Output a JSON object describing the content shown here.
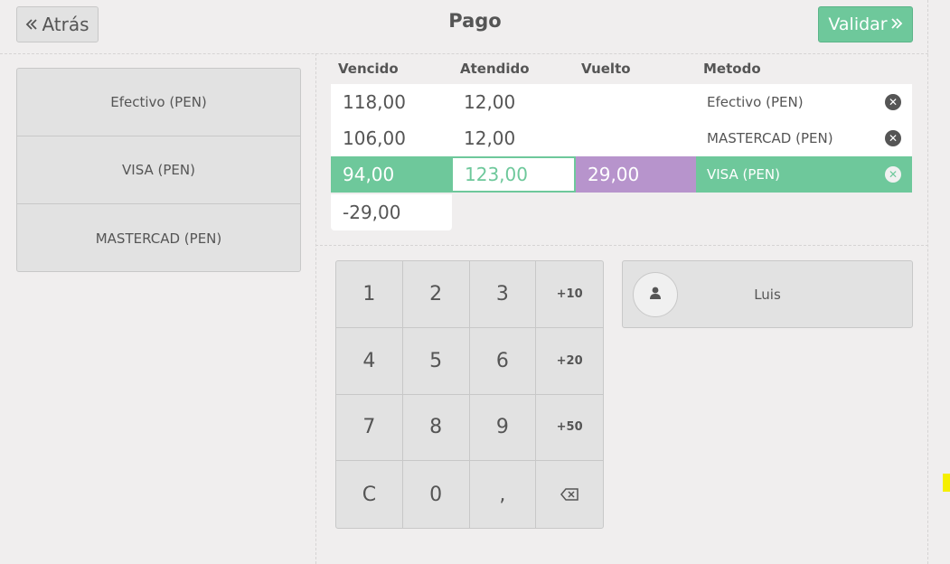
{
  "header": {
    "back_label": "Atrás",
    "title": "Pago",
    "validate_label": "Validar"
  },
  "payment_methods": [
    {
      "label": "Efectivo (PEN)"
    },
    {
      "label": "VISA (PEN)"
    },
    {
      "label": "MASTERCAD (PEN)"
    }
  ],
  "table": {
    "headers": [
      "Vencido",
      "Atendido",
      "Vuelto",
      "Metodo"
    ],
    "lines": [
      {
        "due": "118,00",
        "tendered": "12,00",
        "change": "",
        "method": "Efectivo (PEN)",
        "selected": false
      },
      {
        "due": "106,00",
        "tendered": "12,00",
        "change": "",
        "method": "MASTERCAD (PEN)",
        "selected": false
      },
      {
        "due": "94,00",
        "tendered": "123,00",
        "change": "29,00",
        "method": "VISA (PEN)",
        "selected": true
      }
    ],
    "remaining": "-29,00"
  },
  "numpad": {
    "keys": [
      "1",
      "2",
      "3",
      "+10",
      "4",
      "5",
      "6",
      "+20",
      "7",
      "8",
      "9",
      "+50",
      "C",
      "0",
      ",",
      "backspace"
    ]
  },
  "customer": {
    "name": "Luis"
  },
  "colors": {
    "accent_green": "#6ec89b",
    "change_purple": "#b794cc",
    "background": "#f0eeee",
    "button_gray": "#e2e2e2"
  },
  "icons": {
    "back": "double-chevron-left-icon",
    "validate": "double-chevron-right-icon",
    "delete": "close-circle-icon",
    "backspace": "backspace-icon",
    "avatar": "user-icon"
  }
}
